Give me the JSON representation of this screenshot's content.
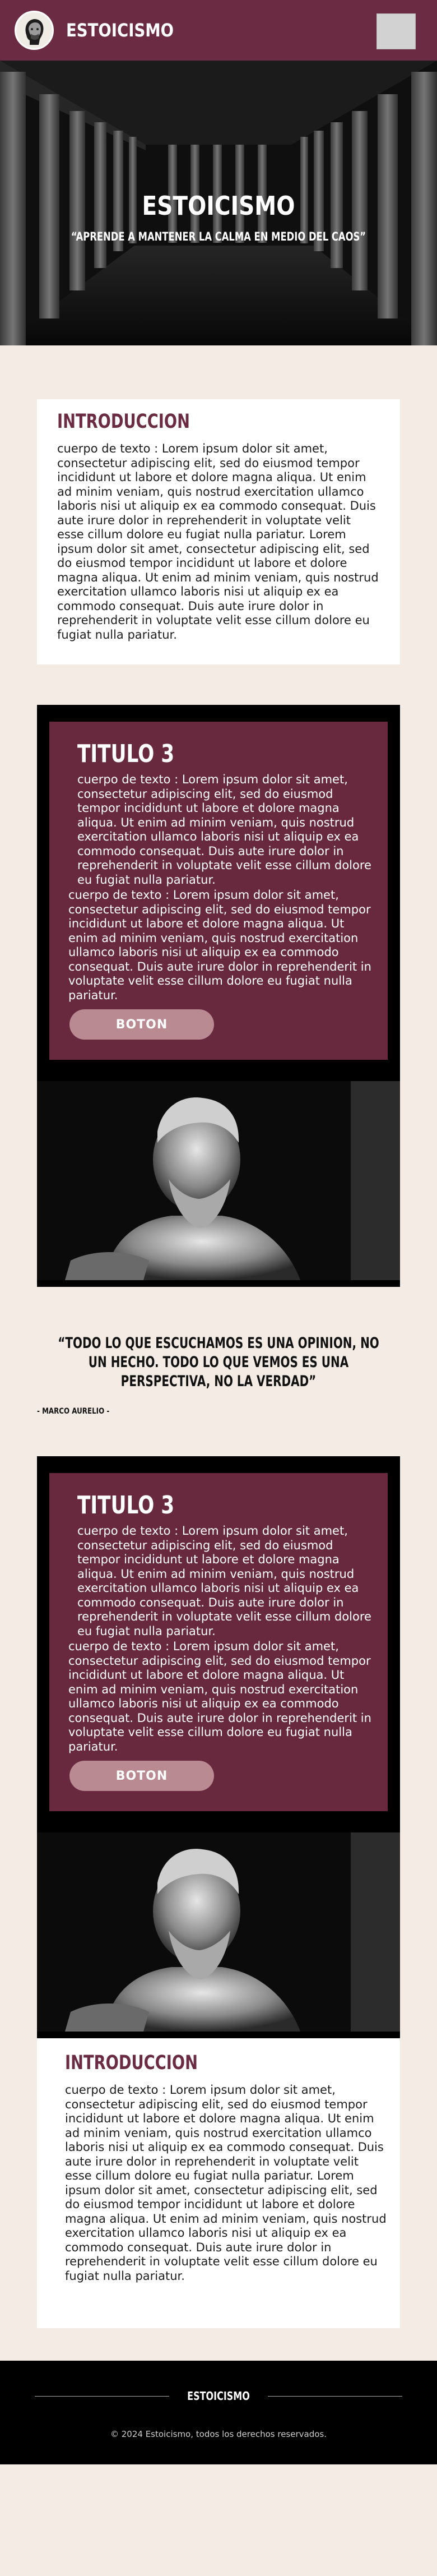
{
  "header": {
    "brand": "ESTOICISMO",
    "logo_icon": "statue-head-logo-icon",
    "menu_icon": "menu-placeholder-icon"
  },
  "hero": {
    "title": "ESTOICISMO",
    "subtitle": "“APRENDE A MANTENER LA CALMA EN MEDIO DEL CAOS”"
  },
  "intro": {
    "title": "INTRODUCCION",
    "body": "cuerpo de texto : Lorem ipsum dolor sit amet, consectetur adipiscing elit, sed do eiusmod tempor incididunt ut labore et dolore magna aliqua. Ut enim ad minim veniam, quis nostrud exercitation ullamco laboris nisi ut aliquip ex ea commodo consequat. Duis aute irure dolor in reprehenderit in voluptate velit esse cillum dolore eu fugiat nulla pariatur. Lorem ipsum dolor sit amet, consectetur adipiscing elit, sed do eiusmod tempor incididunt ut labore et dolore magna aliqua. Ut enim ad minim veniam, quis nostrud exercitation ullamco laboris nisi ut aliquip ex ea commodo consequat. Duis aute irure dolor in reprehenderit in voluptate velit esse cillum dolore eu fugiat nulla pariatur."
  },
  "feature1": {
    "title": "TITULO 3",
    "para1": "cuerpo de texto : Lorem ipsum dolor sit amet, consectetur adipiscing elit, sed do eiusmod tempor incididunt ut labore et dolore magna aliqua. Ut enim ad minim veniam, quis nostrud exercitation ullamco laboris nisi ut aliquip ex ea commodo consequat. Duis aute irure dolor in reprehenderit in voluptate velit esse cillum dolore eu fugiat nulla pariatur.",
    "para2": "cuerpo de texto : Lorem ipsum dolor sit amet, consectetur adipiscing elit, sed do eiusmod tempor incididunt ut labore et dolore magna aliqua. Ut enim ad minim veniam, quis nostrud exercitation ullamco laboris nisi ut aliquip ex ea commodo consequat. Duis aute irure dolor in reprehenderit in voluptate velit esse cillum dolore eu fugiat nulla pariatur.",
    "button": "BOTON",
    "image_icon": "marcus-aurelius-statue-image"
  },
  "quote": {
    "text": "“TODO LO QUE ESCUCHAMOS ES UNA OPINION, NO UN HECHO. TODO LO QUE VEMOS ES UNA PERSPECTIVA, NO LA VERDAD”",
    "author": "- MARCO AURELIO -"
  },
  "feature2": {
    "title": "TITULO 3",
    "para1": "cuerpo de texto : Lorem ipsum dolor sit amet, consectetur adipiscing elit, sed do eiusmod tempor incididunt ut labore et dolore magna aliqua. Ut enim ad minim veniam, quis nostrud exercitation ullamco laboris nisi ut aliquip ex ea commodo consequat. Duis aute irure dolor in reprehenderit in voluptate velit esse cillum dolore eu fugiat nulla pariatur.",
    "para2": "cuerpo de texto : Lorem ipsum dolor sit amet, consectetur adipiscing elit, sed do eiusmod tempor incididunt ut labore et dolore magna aliqua. Ut enim ad minim veniam, quis nostrud exercitation ullamco laboris nisi ut aliquip ex ea commodo consequat. Duis aute irure dolor in reprehenderit in voluptate velit esse cillum dolore eu fugiat nulla pariatur.",
    "button": "BOTON",
    "image_icon": "marcus-aurelius-statue-image"
  },
  "intro2": {
    "title": "INTRODUCCION",
    "body": "cuerpo de texto : Lorem ipsum dolor sit amet, consectetur adipiscing elit, sed do eiusmod tempor incididunt ut labore et dolore magna aliqua. Ut enim ad minim veniam, quis nostrud exercitation ullamco laboris nisi ut aliquip ex ea commodo consequat. Duis aute irure dolor in reprehenderit in voluptate velit esse cillum dolore eu fugiat nulla pariatur. Lorem ipsum dolor sit amet, consectetur adipiscing elit, sed do eiusmod tempor incididunt ut labore et dolore magna aliqua. Ut enim ad minim veniam, quis nostrud exercitation ullamco laboris nisi ut aliquip ex ea commodo consequat. Duis aute irure dolor in reprehenderit in voluptate velit esse cillum dolore eu fugiat nulla pariatur."
  },
  "footer": {
    "brand": "ESTOICISMO",
    "copyright": "© 2024 Estoicismo, todos los derechos reservados."
  },
  "colors": {
    "wine": "#6b2b42",
    "button": "#b98a92",
    "background": "#f3ebe4"
  }
}
